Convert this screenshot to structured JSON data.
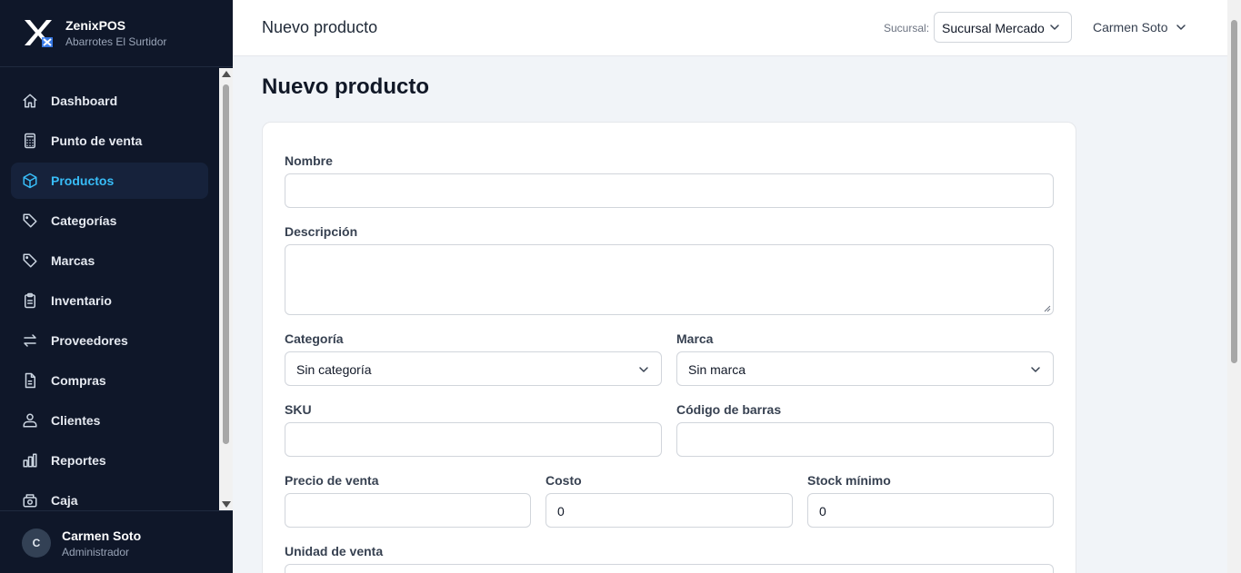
{
  "brand": {
    "name": "ZenixPOS",
    "subtitle": "Abarrotes El Surtidor"
  },
  "sidebar": {
    "items": [
      {
        "label": "Dashboard",
        "icon": "home-icon",
        "active": false
      },
      {
        "label": "Punto de venta",
        "icon": "calculator-icon",
        "active": false
      },
      {
        "label": "Productos",
        "icon": "cube-icon",
        "active": true
      },
      {
        "label": "Categorías",
        "icon": "tag-icon",
        "active": false
      },
      {
        "label": "Marcas",
        "icon": "tag-icon",
        "active": false
      },
      {
        "label": "Inventario",
        "icon": "clipboard-icon",
        "active": false
      },
      {
        "label": "Proveedores",
        "icon": "arrows-swap-icon",
        "active": false
      },
      {
        "label": "Compras",
        "icon": "document-icon",
        "active": false
      },
      {
        "label": "Clientes",
        "icon": "users-icon",
        "active": false
      },
      {
        "label": "Reportes",
        "icon": "bar-chart-icon",
        "active": false
      },
      {
        "label": "Caja",
        "icon": "cash-register-icon",
        "active": false
      }
    ],
    "user": {
      "initial": "C",
      "name": "Carmen Soto",
      "role": "Administrador"
    }
  },
  "topbar": {
    "title": "Nuevo producto",
    "branch_label": "Sucursal:",
    "branch_value": "Sucursal Mercado",
    "user_name": "Carmen Soto"
  },
  "page": {
    "heading": "Nuevo producto"
  },
  "form": {
    "nombre": {
      "label": "Nombre",
      "value": ""
    },
    "descripcion": {
      "label": "Descripción",
      "value": ""
    },
    "categoria": {
      "label": "Categoría",
      "value": "Sin categoría"
    },
    "marca": {
      "label": "Marca",
      "value": "Sin marca"
    },
    "sku": {
      "label": "SKU",
      "value": ""
    },
    "codigo_barras": {
      "label": "Código de barras",
      "value": ""
    },
    "precio_venta": {
      "label": "Precio de venta",
      "value": ""
    },
    "costo": {
      "label": "Costo",
      "value": "0"
    },
    "stock_minimo": {
      "label": "Stock mínimo",
      "value": "0"
    },
    "unidad_venta": {
      "label": "Unidad de venta"
    }
  },
  "colors": {
    "sidebar_bg": "#0f1729",
    "accent": "#38bdf8",
    "active_bg": "#16223b"
  }
}
